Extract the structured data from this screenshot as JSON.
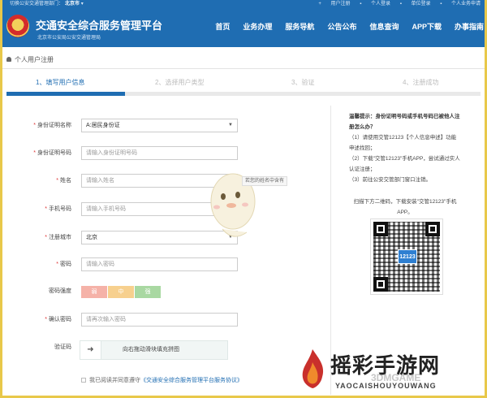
{
  "topbar": {
    "location_prefix": "切换公安交通管理部门",
    "city": "北京市",
    "user_register": "用户注册",
    "personal_login": "个人登录",
    "unit_login": "单位登录",
    "personal_business_apply": "个人业务申请"
  },
  "header": {
    "title": "交通安全综合服务管理平台",
    "subtitle": "北京市公安局公安交通管理局",
    "nav": [
      "首页",
      "业务办理",
      "服务导航",
      "公告公布",
      "信息查询",
      "APP下载",
      "办事指南"
    ]
  },
  "breadcrumb": "个人用户注册",
  "steps": [
    {
      "label": "1、填写用户信息",
      "active": true
    },
    {
      "label": "2、选择用户类型",
      "active": false
    },
    {
      "label": "3、验证",
      "active": false
    },
    {
      "label": "4、注册成功",
      "active": false
    }
  ],
  "step_progress": 0.25,
  "form": {
    "id_type_label": "身份证明名称",
    "id_type_value": "A:居民身份证",
    "id_number_label": "身份证明号码",
    "id_number_placeholder": "请输入身份证明号码",
    "name_label": "姓名",
    "name_placeholder": "请输入姓名",
    "name_tooltip": "若您的姓名中含有",
    "phone_label": "手机号码",
    "phone_placeholder": "请输入手机号码",
    "city_label": "注册城市",
    "city_value": "北京",
    "password_label": "密码",
    "password_placeholder": "请输入密码",
    "strength_label": "密码强度",
    "strength_levels": [
      {
        "label": "弱",
        "color": "#f5b2a8"
      },
      {
        "label": "中",
        "color": "#f7d08e"
      },
      {
        "label": "强",
        "color": "#a9d8a2"
      }
    ],
    "confirm_label": "确认密码",
    "confirm_placeholder": "请再次输入密码",
    "captcha_label": "验证码",
    "captcha_text": "向右拖动滑块填充拼图",
    "agree_prefix": "我已阅读并同意遵守",
    "agree_link": "《交通安全综合服务管理平台服务协议》"
  },
  "tips": {
    "heading": "温馨提示：身份证明号码或手机号码已被他人注册怎么办？",
    "item1": "（1）请使用交管12123【个人信息申述】功能申述找回；",
    "item2": "（2）下载\"交管12123\"手机APP，尝试通过实人认证注册；",
    "item3": "（3）前往公安交管部门窗口注销。",
    "scan_note": "扫描下方二维码，下载安装\"交管12123\"手机APP。",
    "qr_label": "12123"
  },
  "watermark": {
    "cn": "摇彩手游网",
    "en": "YAOCAISHOUYOUWANG",
    "ghost": "3DMGAME"
  },
  "colors": {
    "brand_blue": "#1f6db2",
    "required_red": "#d33333",
    "frame_yellow": "#e8c84a"
  }
}
